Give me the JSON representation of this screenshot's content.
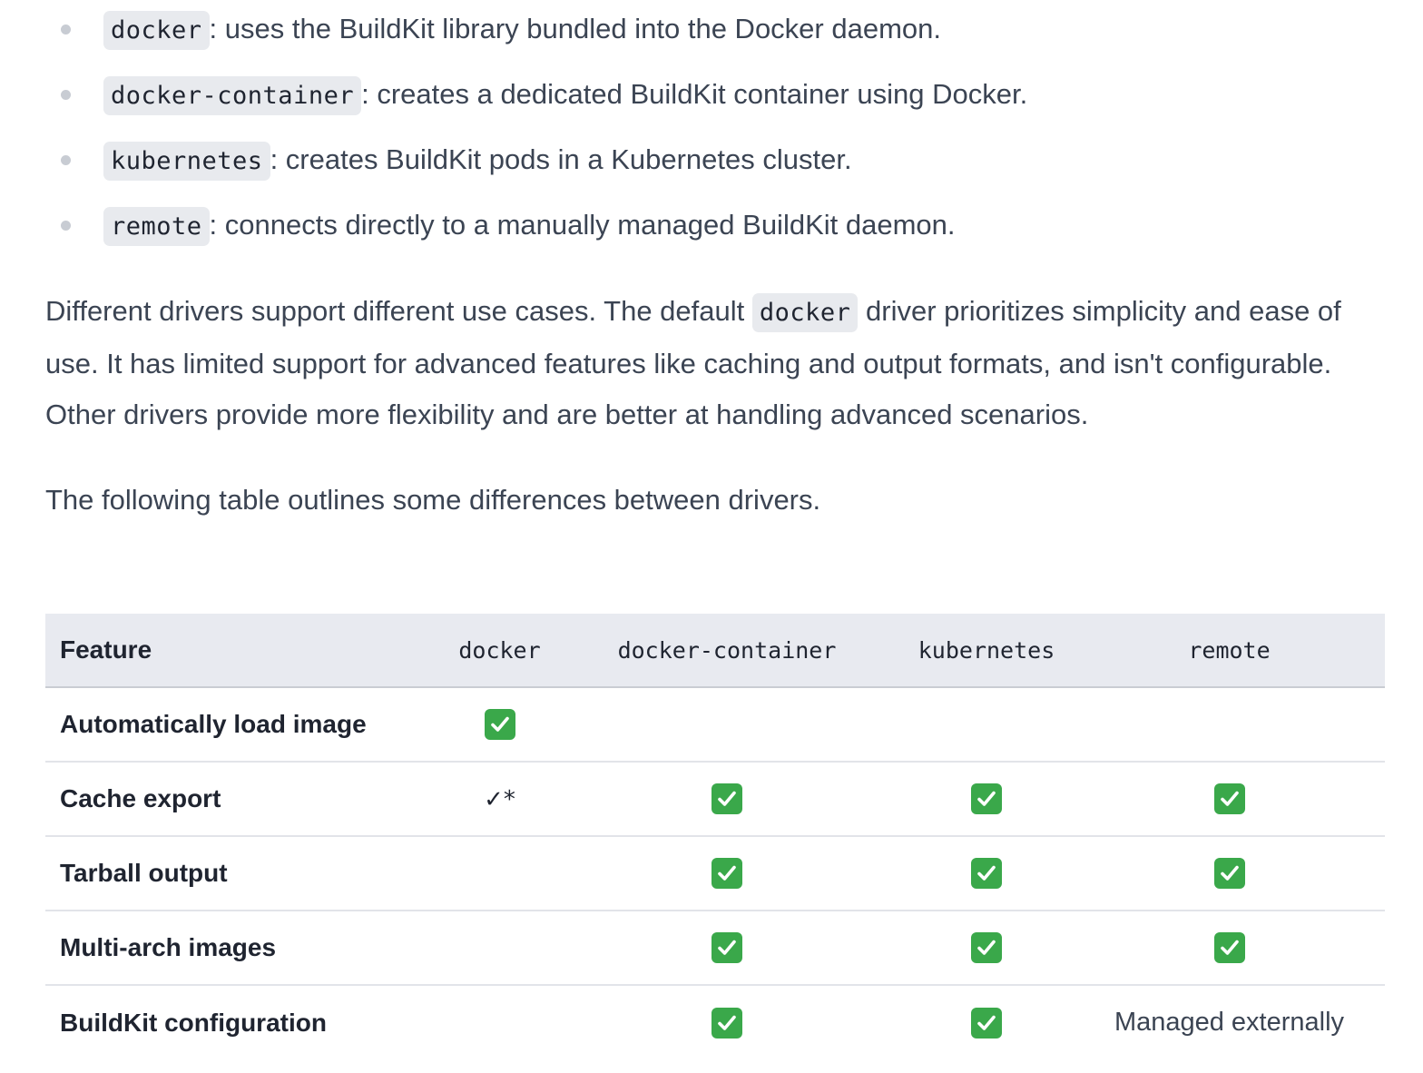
{
  "drivers_list": [
    {
      "code": "docker",
      "text": ": uses the BuildKit library bundled into the Docker daemon."
    },
    {
      "code": "docker-container",
      "text": ": creates a dedicated BuildKit container using Docker."
    },
    {
      "code": "kubernetes",
      "text": ": creates BuildKit pods in a Kubernetes cluster."
    },
    {
      "code": "remote",
      "text": ": connects directly to a manually managed BuildKit daemon."
    }
  ],
  "paragraph1": {
    "before": "Different drivers support different use cases. The default ",
    "code": "docker",
    "after": " driver prioritizes simplicity and ease of use. It has limited support for advanced features like caching and output formats, and isn't configurable. Other drivers provide more flexibility and are better at handling advanced scenarios."
  },
  "paragraph2": "The following table outlines some differences between drivers.",
  "table": {
    "headers": [
      "Feature",
      "docker",
      "docker-container",
      "kubernetes",
      "remote"
    ],
    "rows": [
      {
        "feature": "Automatically load image",
        "docker": "check",
        "docker_container": "",
        "kubernetes": "",
        "remote": ""
      },
      {
        "feature": "Cache export",
        "docker": "✓*",
        "docker_container": "check",
        "kubernetes": "check",
        "remote": "check"
      },
      {
        "feature": "Tarball output",
        "docker": "",
        "docker_container": "check",
        "kubernetes": "check",
        "remote": "check"
      },
      {
        "feature": "Multi-arch images",
        "docker": "",
        "docker_container": "check",
        "kubernetes": "check",
        "remote": "check"
      },
      {
        "feature": "BuildKit configuration",
        "docker": "",
        "docker_container": "check",
        "kubernetes": "check",
        "remote": "Managed externally"
      }
    ]
  },
  "colors": {
    "text": "#3b4453",
    "code_bg": "#e8eaee",
    "header_bg": "#e8eaf0",
    "check_green": "#3aa84a"
  }
}
